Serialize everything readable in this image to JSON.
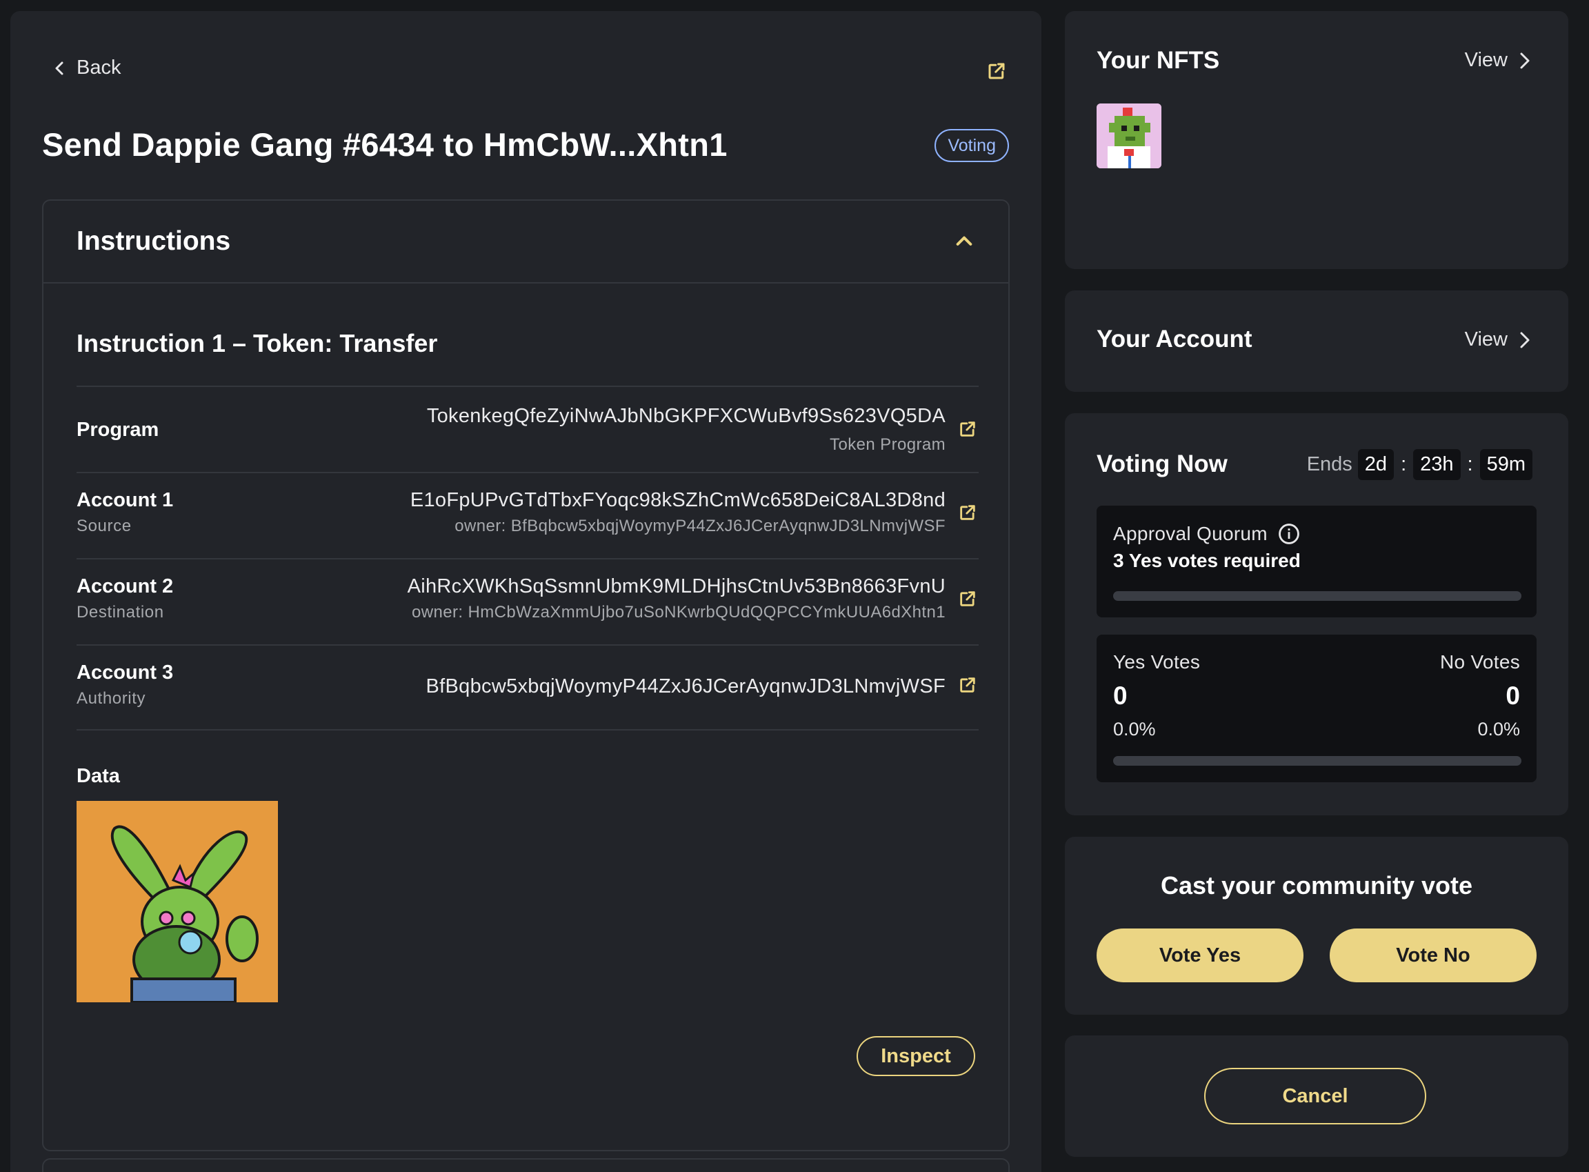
{
  "header": {
    "back_label": "Back",
    "title": "Send Dappie Gang #6434 to HmCbW...Xhtn1",
    "status_badge": "Voting"
  },
  "instructions": {
    "section_title": "Instructions",
    "instruction_title": "Instruction 1 – Token: Transfer",
    "rows": [
      {
        "label": "Program",
        "sublabel": "",
        "value": "TokenkegQfeZyiNwAJbNbGKPFXCWuBvf9Ss623VQ5DA",
        "note": "Token Program"
      },
      {
        "label": "Account 1",
        "sublabel": "Source",
        "value": "E1oFpUPvGTdTbxFYoqc98kSZhCmWc658DeiC8AL3D8nd",
        "note": "owner: BfBqbcw5xbqjWoymyP44ZxJ6JCerAyqnwJD3LNmvjWSF"
      },
      {
        "label": "Account 2",
        "sublabel": "Destination",
        "value": "AihRcXWKhSqSsmnUbmK9MLDHjhsCtnUv53Bn8663FvnU",
        "note": "owner: HmCbWzaXmmUjbo7uSoNKwrbQUdQQPCCYmkUUA6dXhtn1"
      },
      {
        "label": "Account 3",
        "sublabel": "Authority",
        "value": "BfBqbcw5xbqjWoymyP44ZxJ6JCerAyqnwJD3LNmvjWSF",
        "note": ""
      }
    ],
    "data_label": "Data",
    "inspect_label": "Inspect"
  },
  "nfts": {
    "title": "Your NFTS",
    "view_label": "View"
  },
  "account": {
    "title": "Your Account",
    "view_label": "View"
  },
  "voting": {
    "title": "Voting Now",
    "ends_label": "Ends",
    "days": "2d",
    "hours": "23h",
    "minutes": "59m",
    "quorum_label": "Approval Quorum",
    "quorum_required": "3 Yes votes required",
    "quorum_progress": 0,
    "yes_label": "Yes Votes",
    "no_label": "No Votes",
    "yes_count": "0",
    "no_count": "0",
    "yes_pct": "0.0%",
    "no_pct": "0.0%",
    "yes_fraction": 0
  },
  "cast": {
    "title": "Cast your community vote",
    "yes_label": "Vote Yes",
    "no_label": "Vote No"
  },
  "cancel_label": "Cancel",
  "colors": {
    "accent": "#ebd584",
    "badge": "#8fb3ff",
    "panel": "#222429",
    "inner": "#101114"
  }
}
